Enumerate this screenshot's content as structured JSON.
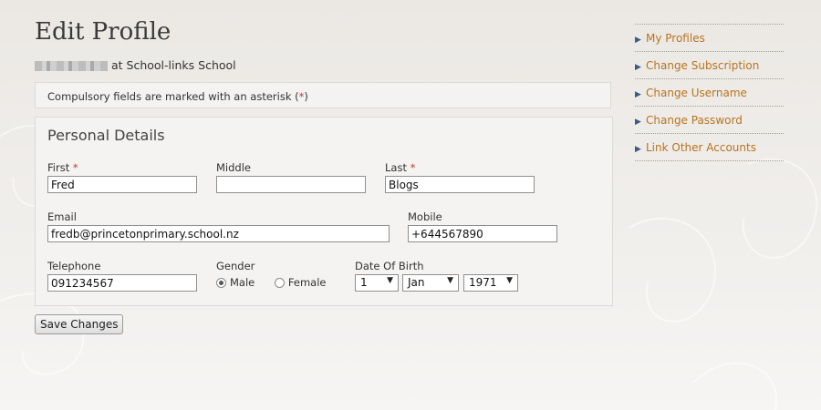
{
  "page": {
    "title": "Edit Profile",
    "subtitle_suffix": "at School-links School",
    "notice_text": "Compulsory fields are marked with an asterisk (",
    "notice_end": ")",
    "asterisk": "*"
  },
  "form": {
    "section_title": "Personal Details",
    "first": {
      "label": "First",
      "value": "Fred"
    },
    "middle": {
      "label": "Middle",
      "value": ""
    },
    "last": {
      "label": "Last",
      "value": "Blogs"
    },
    "email": {
      "label": "Email",
      "value": "fredb@princetonprimary.school.nz"
    },
    "mobile": {
      "label": "Mobile",
      "value": "+644567890"
    },
    "telephone": {
      "label": "Telephone",
      "value": "091234567"
    },
    "gender": {
      "label": "Gender",
      "options": [
        "Male",
        "Female"
      ],
      "selected": "Male"
    },
    "dob": {
      "label": "Date Of Birth",
      "day": "1",
      "month": "Jan",
      "year": "1971"
    },
    "save_label": "Save Changes"
  },
  "sidebar": {
    "items": [
      {
        "label": "My Profiles"
      },
      {
        "label": "Change Subscription"
      },
      {
        "label": "Change Username"
      },
      {
        "label": "Change Password"
      },
      {
        "label": "Link Other Accounts"
      }
    ]
  },
  "colors": {
    "link": "#b8741e",
    "arrow": "#3b5b80",
    "required": "#c0392b"
  },
  "icons": {
    "sidebar_arrow": "triangle-right-icon",
    "select_arrow": "triangle-down-icon"
  }
}
